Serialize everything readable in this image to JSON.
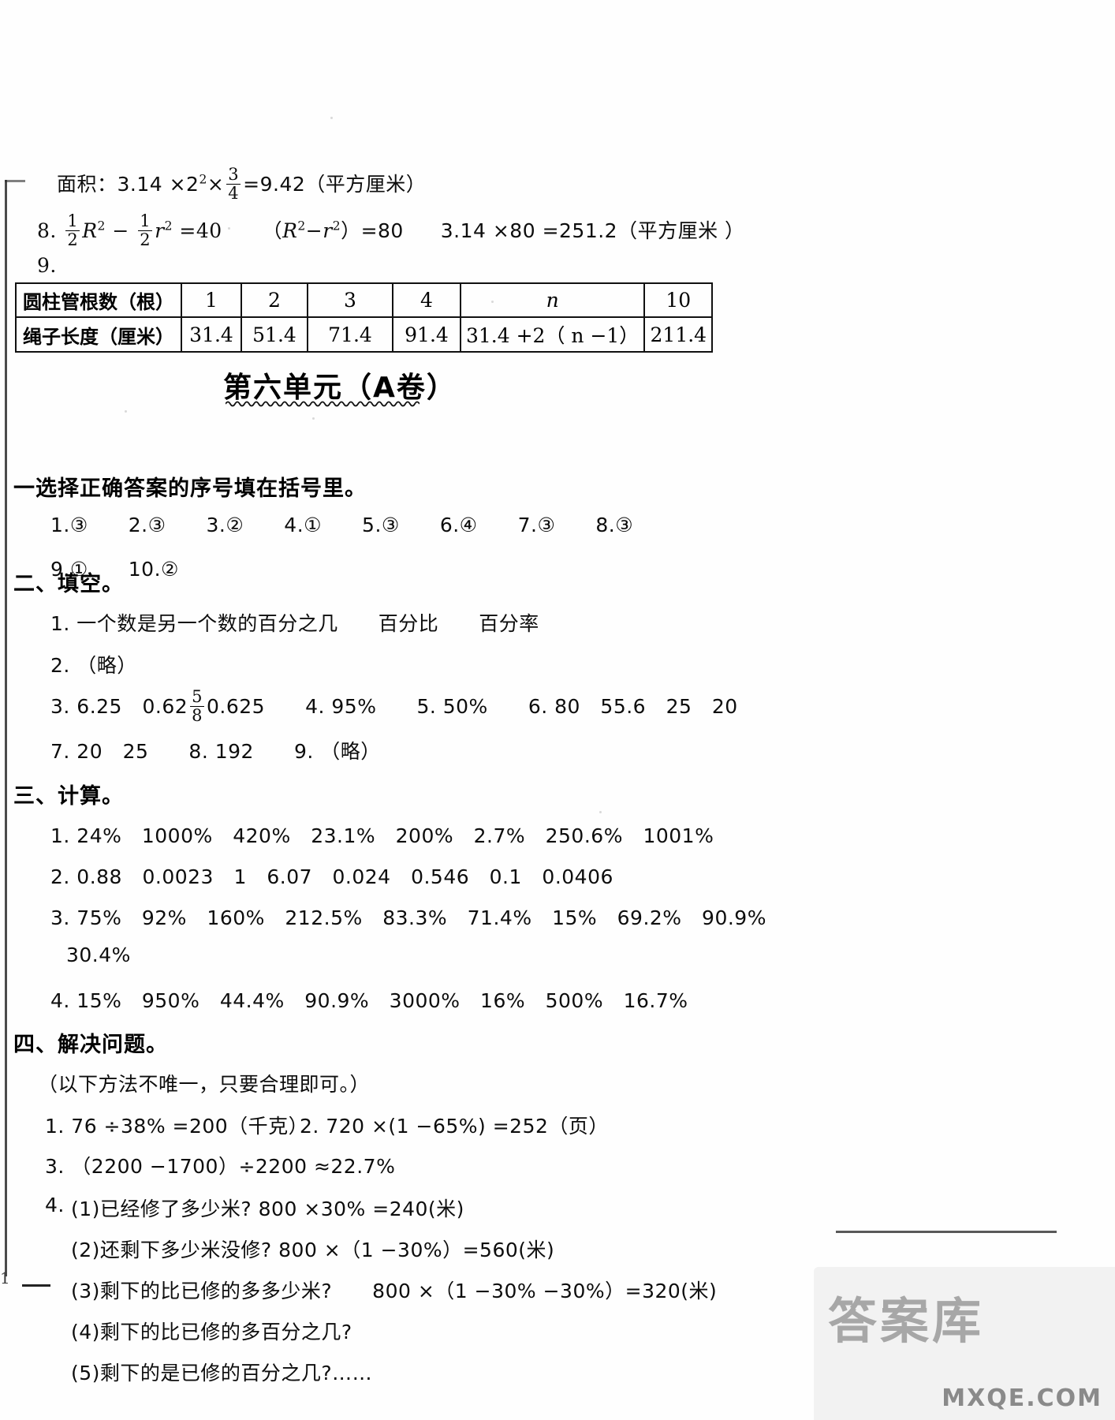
{
  "page": {
    "number": "1",
    "watermark_main": "答案库",
    "watermark_sub": "MXQE.COM"
  },
  "top_answers": {
    "area_line": {
      "prefix": "面积：3.14 ×2",
      "exp": "2",
      "times": "×",
      "frac_num": "3",
      "frac_den": "4",
      "result": "=9.42（平方厘米）"
    },
    "item8": {
      "index": "8.",
      "f1_num": "1",
      "f1_den": "2",
      "var1": "R",
      "var1_exp": "2",
      "minus": "−",
      "f2_num": "1",
      "f2_den": "2",
      "var2": "r",
      "var2_exp": "2",
      "eq40": "=40",
      "paren_open": "（",
      "v3": "R",
      "v3_exp": "2",
      "dash": "−",
      "v4": "r",
      "v4_exp": "2",
      "paren_close": "）=80",
      "tail": "3.14 ×80 =251.2（平方厘米 ）"
    },
    "item9": "9."
  },
  "table": {
    "rows": [
      {
        "label": "圆柱管根数（根）",
        "cells": [
          "1",
          "2",
          "3",
          "4",
          "n",
          "10"
        ]
      },
      {
        "label": "绳子长度（厘米）",
        "cells": [
          "31.4",
          "51.4",
          "71.4",
          "91.4",
          "31.4 +2（ n −1）",
          "211.4"
        ]
      }
    ]
  },
  "unit": {
    "title": "第六单元（A卷）"
  },
  "section1": {
    "heading": "一选择正确答案的序号填在括号里。",
    "row1": "1.③　　2.③　　3.②　　4.①　　5.③　　6.④　　7.③　　8.③",
    "row2": "9.①　　10.②"
  },
  "section2": {
    "heading": "二、填空。",
    "item1": "1. 一个数是另一个数的百分之几　　百分比　　百分率",
    "item2": "2. （略）",
    "item3_pre": "3. 6.25　0.62",
    "item3_frac_num": "5",
    "item3_frac_den": "8",
    "item3_post": "0.625　　4. 95%　　5. 50%　　6. 80　55.6　25　20",
    "item7": "7. 20　25　　8. 192　　9. （略）"
  },
  "section3": {
    "heading": "三、计算。",
    "item1": "1. 24%　1000%　420%　23.1%　200%　2.7%　250.6%　1001%",
    "item2": "2. 0.88　0.0023　1　6.07　0.024　0.546　0.1　0.0406",
    "item3": "3. 75%　92%　160%　212.5%　83.3%　71.4%　15%　69.2%　90.9%",
    "item3_cont": "30.4%",
    "item4": "4. 15%　950%　44.4%　90.9%　3000%　16%　500%　16.7%"
  },
  "section4": {
    "heading": "四、解决问题。",
    "note": "（以下方法不唯一，只要合理即可。）",
    "item1": "1. 76 ÷38% =200（千克）",
    "item2": "2. 720 ×(1 −65%) =252（页）",
    "item3": "3. （2200 −1700）÷2200 ≈22.7%",
    "item4_label": "4.",
    "item4_sub1": "(1)已经修了多少米? 800 ×30% =240(米)",
    "item4_sub2": "(2)还剩下多少米没修? 800 ×（1 −30%）=560(米)",
    "item4_sub3": "(3)剩下的比已修的多多少米?　　800 ×（1 −30% −30%）=320(米)",
    "item4_sub4": "(4)剩下的比已修的多百分之几?",
    "item4_sub5": "(5)剩下的是已修的百分之几?……"
  }
}
